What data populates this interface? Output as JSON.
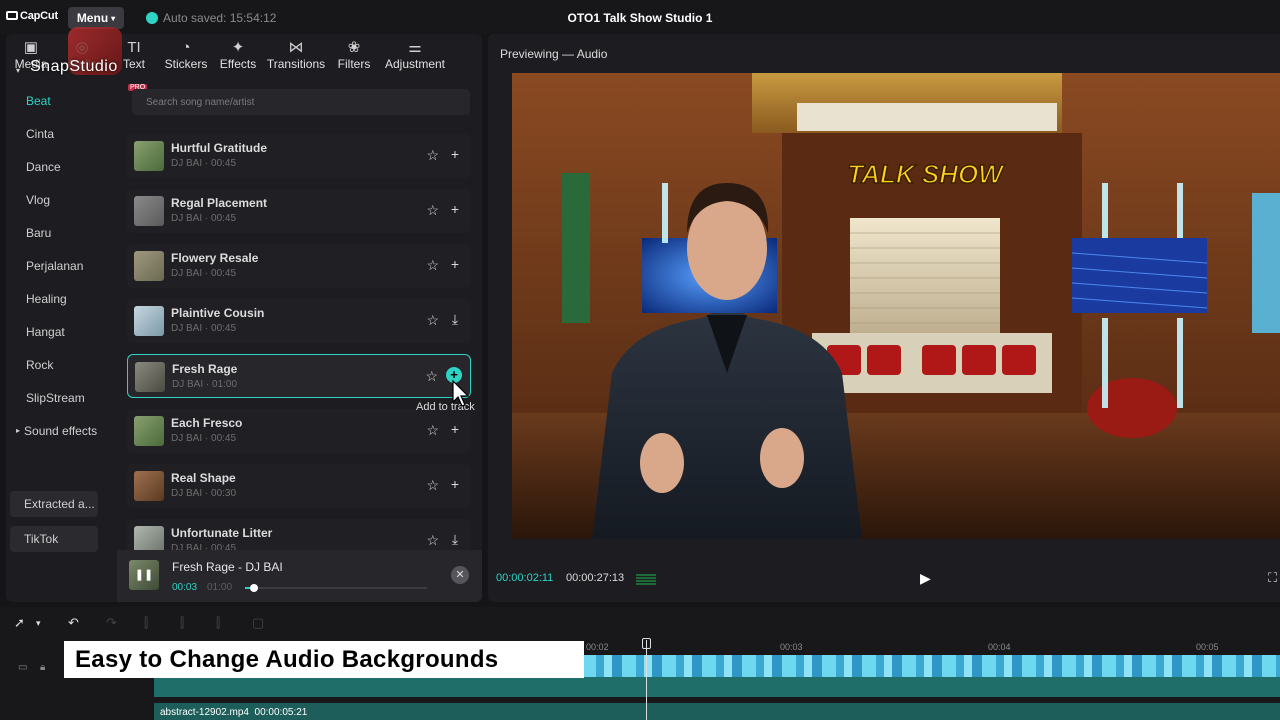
{
  "topbar": {
    "logo": "CapCut",
    "menu_label": "Menu",
    "autosave": "Auto saved: 15:54:12",
    "project_title": "OTO1 Talk Show Studio 1"
  },
  "tools": [
    {
      "label": "Media",
      "icon": "media-icon",
      "glyph": "▣"
    },
    {
      "label": "Audio",
      "icon": "audio-icon",
      "glyph": "◎"
    },
    {
      "label": "Text",
      "icon": "text-icon",
      "glyph": "TI"
    },
    {
      "label": "Stickers",
      "icon": "stickers-icon",
      "glyph": "◔"
    },
    {
      "label": "Effects",
      "icon": "effects-icon",
      "glyph": "✦"
    },
    {
      "label": "Transitions",
      "icon": "transitions-icon",
      "glyph": "⋈"
    },
    {
      "label": "Filters",
      "icon": "filters-icon",
      "glyph": "❀"
    },
    {
      "label": "Adjustment",
      "icon": "adjustment-icon",
      "glyph": "⚌"
    }
  ],
  "watermark": "SnapStudio",
  "pro_badge": "PRO",
  "search_placeholder": "Search song name/artist",
  "categories": [
    "Beat",
    "Cinta",
    "Dance",
    "Vlog",
    "Baru",
    "Perjalanan",
    "Healing",
    "Hangat",
    "Rock",
    "SlipStream"
  ],
  "sound_effects_group": "Sound effects",
  "extracted_label": "Extracted a...",
  "tiktok_label": "TikTok",
  "songs": [
    {
      "title": "Hurtful Gratitude",
      "artist": "DJ BAI · 00:45",
      "action": "+"
    },
    {
      "title": "Regal Placement",
      "artist": "DJ BAI · 00:45",
      "action": "+"
    },
    {
      "title": "Flowery Resale",
      "artist": "DJ BAI · 00:45",
      "action": "+"
    },
    {
      "title": "Plaintive Cousin",
      "artist": "DJ BAI · 00:45",
      "action": "⤓"
    },
    {
      "title": "Fresh Rage",
      "artist": "DJ BAI · 01:00",
      "action": "+"
    },
    {
      "title": "Each Fresco",
      "artist": "DJ BAI · 00:45",
      "action": "+"
    },
    {
      "title": "Real Shape",
      "artist": "DJ BAI · 00:30",
      "action": "+"
    },
    {
      "title": "Unfortunate Litter",
      "artist": "DJ BAI · 00:45",
      "action": "⤓"
    }
  ],
  "tooltip": "Add to track",
  "player": {
    "title": "Fresh Rage - DJ BAI",
    "current": "00:03",
    "total": "01:00",
    "progress": 0.05
  },
  "preview": {
    "title": "Previewing — Audio",
    "timecode_current": "00:00:02:11",
    "timecode_total": "00:00:27:13",
    "sign_text": "TALK SHOW"
  },
  "timeline": {
    "caption": "Easy to Change Audio Backgrounds",
    "ruler": [
      "00:02",
      "00:03",
      "00:04",
      "00:05"
    ],
    "clip_name": "abstract-12902.mp4",
    "clip_duration": "00:00:05:21"
  },
  "colors": {
    "accent": "#2fd3c4",
    "panel": "#1d1d21",
    "background": "#151518"
  }
}
